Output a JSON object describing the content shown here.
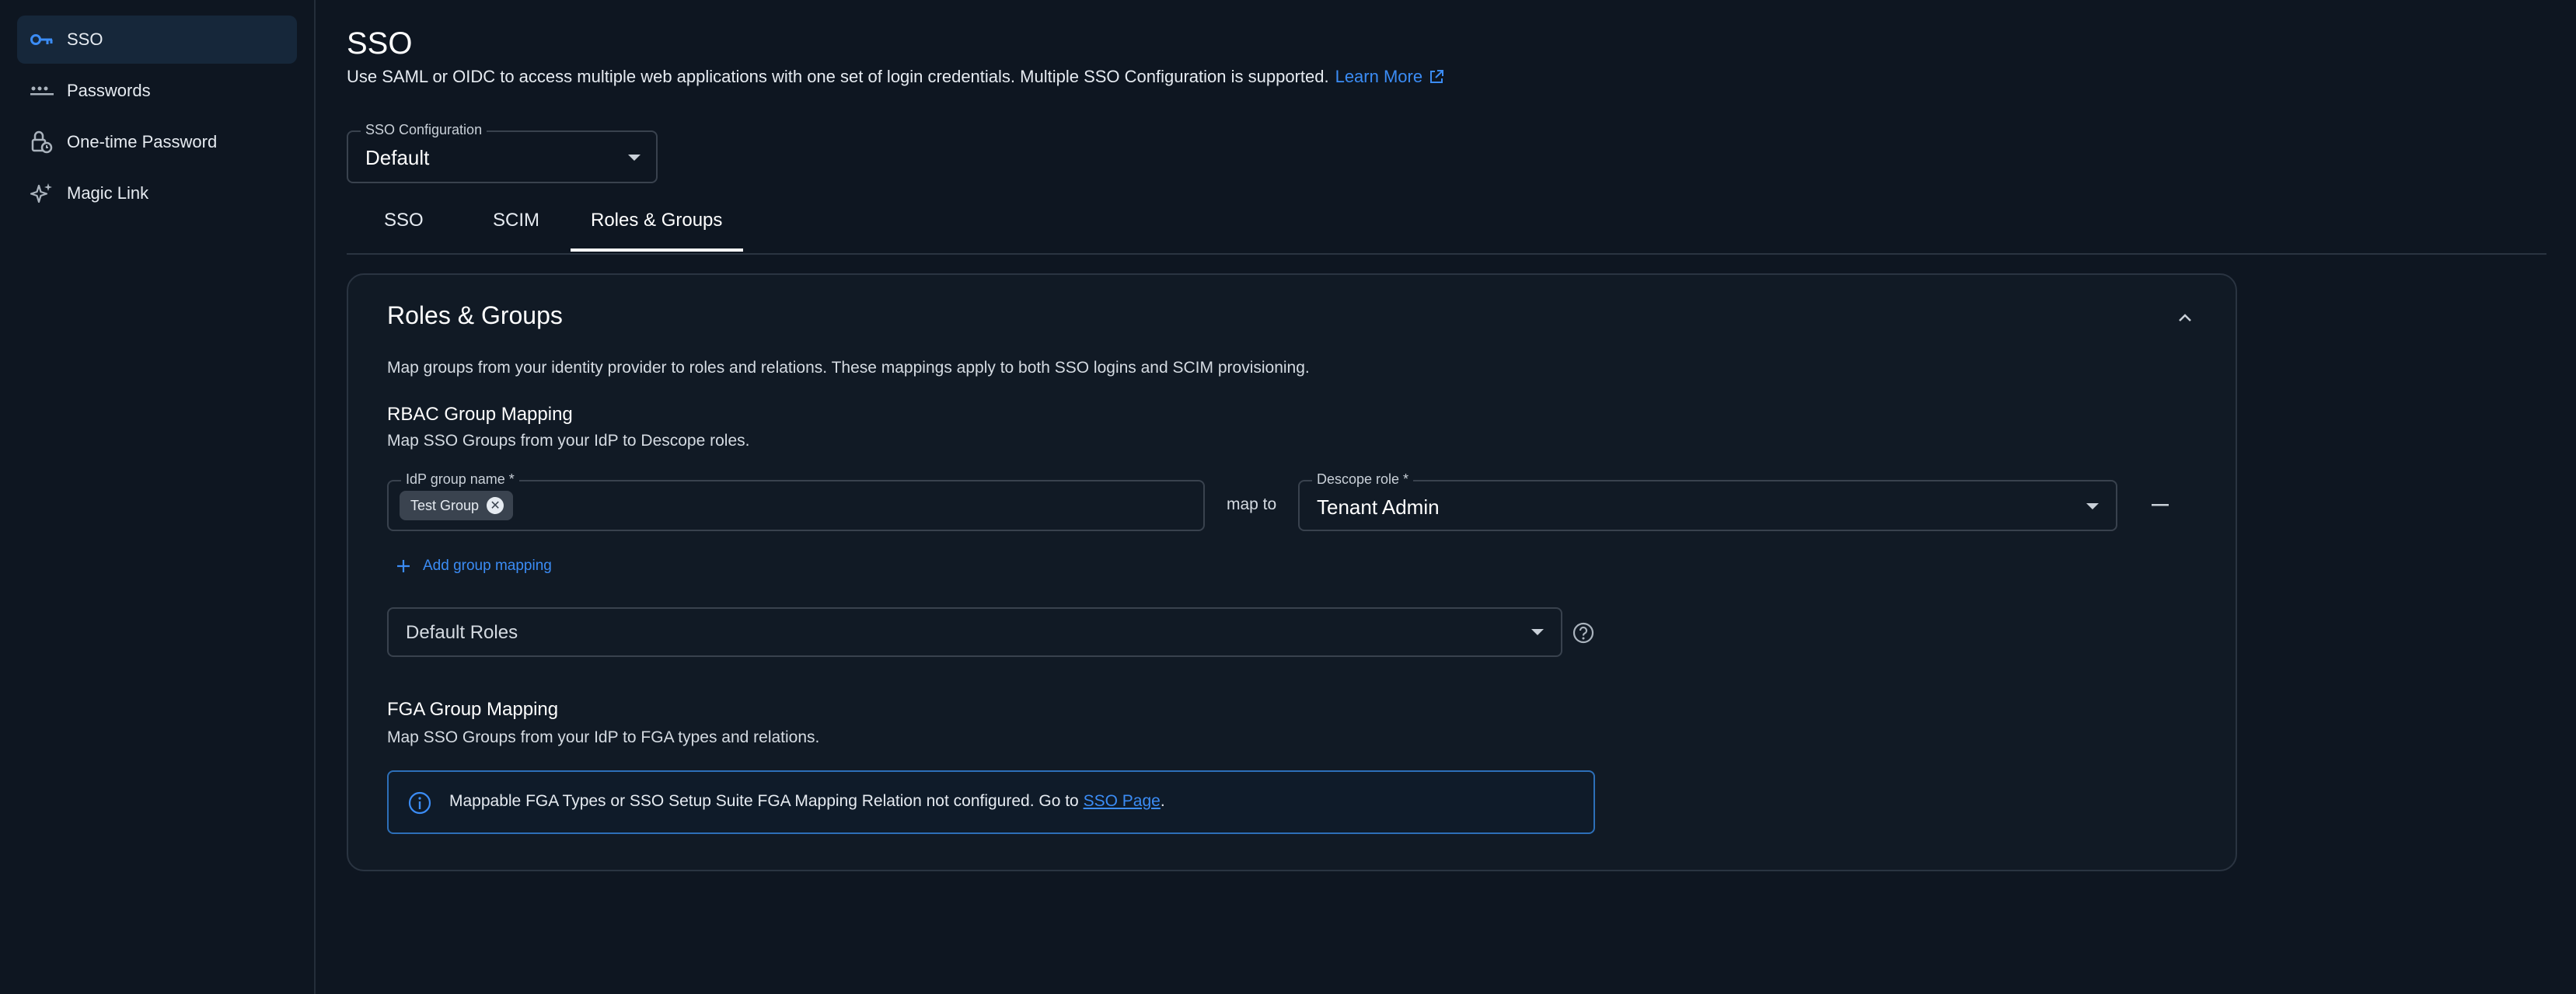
{
  "sidebar": {
    "items": [
      {
        "label": "SSO",
        "icon": "key-icon",
        "active": true
      },
      {
        "label": "Passwords",
        "icon": "password-dots-icon",
        "active": false
      },
      {
        "label": "One-time Password",
        "icon": "lock-clock-icon",
        "active": false
      },
      {
        "label": "Magic Link",
        "icon": "sparkle-icon",
        "active": false
      }
    ]
  },
  "header": {
    "title": "SSO",
    "subtitle": "Use SAML or OIDC to access multiple web applications with one set of login credentials. Multiple SSO Configuration is supported.",
    "learn_more": "Learn More"
  },
  "config_select": {
    "label": "SSO Configuration",
    "value": "Default"
  },
  "tabs": [
    {
      "label": "SSO",
      "active": false
    },
    {
      "label": "SCIM",
      "active": false
    },
    {
      "label": "Roles & Groups",
      "active": true
    }
  ],
  "card": {
    "title": "Roles & Groups",
    "description": "Map groups from your identity provider to roles and relations. These mappings apply to both SSO logins and SCIM provisioning.",
    "rbac": {
      "title": "RBAC Group Mapping",
      "description": "Map SSO Groups from your IdP to Descope roles.",
      "idp_label": "IdP group name *",
      "chip": "Test Group",
      "map_to": "map to",
      "role_label": "Descope role *",
      "role_value": "Tenant Admin",
      "add_mapping": "Add group mapping",
      "default_roles_placeholder": "Default Roles"
    },
    "fga": {
      "title": "FGA Group Mapping",
      "description": "Map SSO Groups from your IdP to FGA types and relations.",
      "info_text": "Mappable FGA Types or SSO Setup Suite FGA Mapping Relation not configured. Go to",
      "info_link": "SSO Page",
      "info_suffix": "."
    }
  },
  "colors": {
    "background": "#0e1621",
    "accent": "#3b8cf5",
    "active_nav": "#16273a",
    "info_border": "#2d6fb8"
  }
}
